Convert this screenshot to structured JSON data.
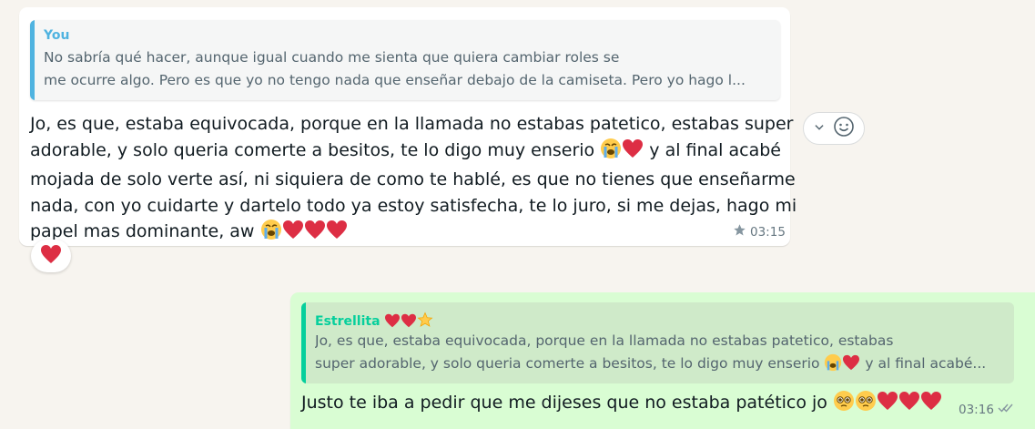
{
  "incoming": {
    "quote": {
      "author": "You",
      "line1": "No sabría qué hacer, aunque igual cuando me sienta que quiera cambiar roles se",
      "line2": "me ocurre algo. Pero es que yo no tengo nada que enseñar debajo de la camiseta. Pero yo hago l..."
    },
    "body": {
      "line1": "Jo, es que, estaba equivocada, porque en la llamada no estabas patetico, estabas super",
      "line2a": "adorable, y solo queria comerte a besitos, te lo digo muy enserio",
      "line2b": "y al final acabé",
      "line3": "mojada de solo verte así, ni siquiera de como te hablé, es que no tienes que enseñarme",
      "line4": "nada, con yo cuidarte y dartelo todo ya estoy satisfecha, te lo juro, si me dejas, hago mi",
      "line5": "papel mas dominante, aw"
    },
    "time": "03:15",
    "starred": true,
    "reaction": "red-heart"
  },
  "outgoing": {
    "quote": {
      "author": "Estrellita",
      "line1": "Jo, es que, estaba equivocada, porque en la llamada no estabas patetico, estabas",
      "line2a": "super adorable, y solo queria comerte a besitos, te lo digo muy enserio",
      "line2b": "y al final acabé..."
    },
    "body": "Justo te iba a pedir que me dijeses que no estaba patético jo",
    "time": "03:16",
    "status": "read"
  },
  "colors": {
    "you_accent": "#06cf9c",
    "you_name": "#4fb3e0",
    "estrellita_name": "#06cf9c",
    "outgoing_bg": "#d9fdd3",
    "chat_bg": "#f7f4ef"
  }
}
